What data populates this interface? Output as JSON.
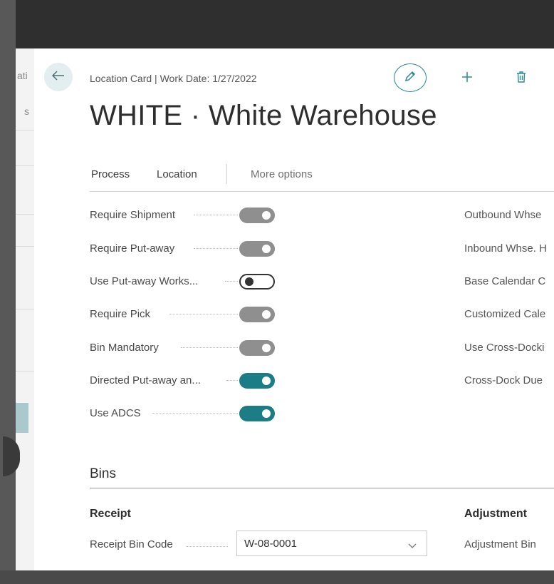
{
  "background": {
    "left_partial_text": "ati",
    "left_partial_text2": "s"
  },
  "header": {
    "breadcrumb": "Location Card | Work Date: 1/27/2022",
    "title": "WHITE · White Warehouse"
  },
  "action_bar": {
    "process": "Process",
    "location": "Location",
    "more_options": "More options"
  },
  "warehouse_fields": [
    {
      "label": "Require Shipment",
      "value": "on",
      "style": "gray"
    },
    {
      "label": "Require Put-away",
      "value": "on",
      "style": "gray"
    },
    {
      "label": "Use Put-away Works...",
      "value": "off",
      "style": "off"
    },
    {
      "label": "Require Pick",
      "value": "on",
      "style": "gray"
    },
    {
      "label": "Bin Mandatory",
      "value": "on",
      "style": "gray"
    },
    {
      "label": "Directed Put-away an...",
      "value": "on",
      "style": "teal"
    },
    {
      "label": "Use ADCS",
      "value": "on",
      "style": "teal"
    }
  ],
  "right_fields": [
    "Outbound Whse",
    "Inbound Whse. H",
    "Base Calendar C",
    "Customized Cale",
    "Use Cross-Docki",
    "Cross-Dock Due"
  ],
  "bins": {
    "section_title": "Bins",
    "receipt_heading": "Receipt",
    "adjustment_heading": "Adjustment",
    "receipt_bin_label": "Receipt Bin Code",
    "receipt_bin_value": "W-08-0001",
    "adjustment_bin_label": "Adjustment Bin"
  },
  "colors": {
    "accent": "#1d7d86",
    "toggle_gray": "#8f8f8f"
  }
}
